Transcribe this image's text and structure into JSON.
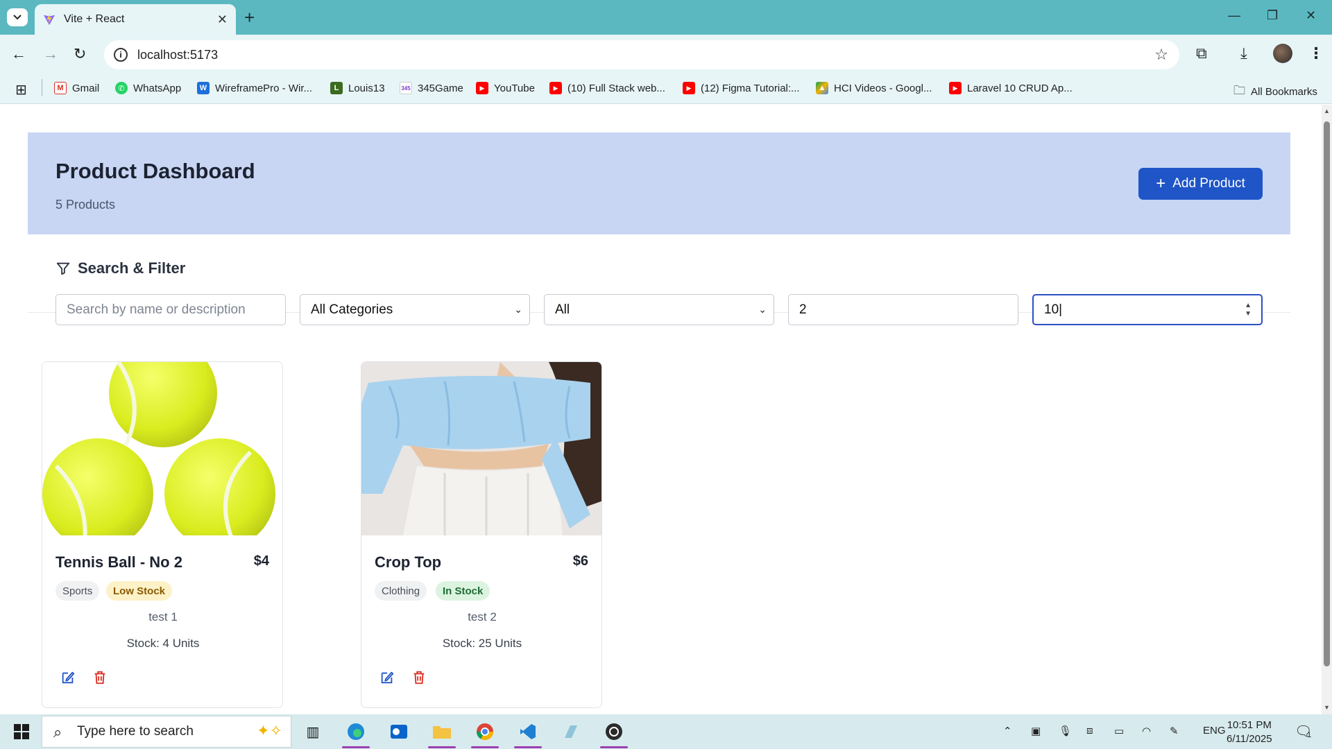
{
  "browser": {
    "tab_title": "Vite + React",
    "url": "localhost:5173",
    "bookmarks": [
      "Gmail",
      "WhatsApp",
      "WireframePro - Wir...",
      "Louis13",
      "345Game",
      "YouTube",
      "(10) Full Stack web...",
      "(12) Figma Tutorial:...",
      "HCI Videos - Googl...",
      "Laravel 10 CRUD Ap..."
    ],
    "all_bookmarks": "All Bookmarks"
  },
  "header": {
    "title": "Product Dashboard",
    "count": "5 Products",
    "add_button": "Add Product"
  },
  "filters": {
    "title": "Search & Filter",
    "search_placeholder": "Search by name or description",
    "category": "All Categories",
    "stock": "All",
    "min_price": "2",
    "max_price": "10"
  },
  "products": [
    {
      "name": "Tennis Ball - No 2",
      "price": "$4",
      "category": "Sports",
      "stock_status": "Low Stock",
      "description": "test 1",
      "stock": "Stock: 4 Units"
    },
    {
      "name": "Crop Top",
      "price": "$6",
      "category": "Clothing",
      "stock_status": "In Stock",
      "description": "test 2",
      "stock": "Stock: 25 Units"
    }
  ],
  "taskbar": {
    "search_placeholder": "Type here to search",
    "language": "ENG",
    "time": "10:51 PM",
    "date": "6/11/2025",
    "notifications": "1"
  },
  "colors": {
    "primary": "#1f55c7",
    "header_bg": "#c8d6f4",
    "low_stock": "#fdf2c7",
    "in_stock": "#dcf3e0",
    "delete": "#d92d20"
  }
}
